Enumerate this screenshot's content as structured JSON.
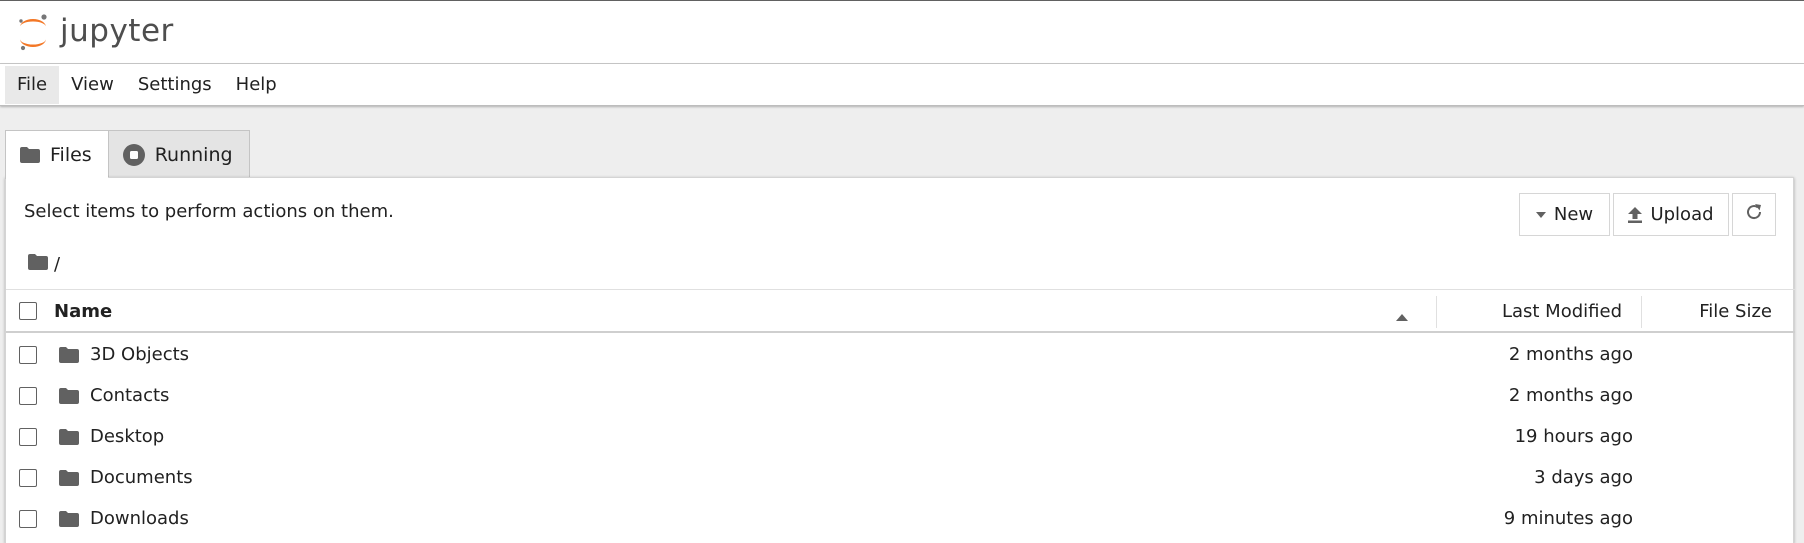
{
  "app": {
    "logo_text": "jupyter"
  },
  "menu": [
    {
      "label": "File",
      "active": true
    },
    {
      "label": "View"
    },
    {
      "label": "Settings"
    },
    {
      "label": "Help"
    }
  ],
  "tabs": [
    {
      "label": "Files",
      "icon": "folder-icon",
      "active": true
    },
    {
      "label": "Running",
      "icon": "stop-circle-icon",
      "active": false
    }
  ],
  "browser": {
    "instructions": "Select items to perform actions on them.",
    "buttons": {
      "new_label": "New",
      "upload_label": "Upload",
      "refresh_icon": "refresh-icon"
    },
    "breadcrumb": "/",
    "columns": {
      "name": "Name",
      "last_modified": "Last Modified",
      "file_size": "File Size"
    },
    "rows": [
      {
        "name": "3D Objects",
        "modified": "2 months ago",
        "icon": "folder-icon"
      },
      {
        "name": "Contacts",
        "modified": "2 months ago",
        "icon": "folder-icon"
      },
      {
        "name": "Desktop",
        "modified": "19 hours ago",
        "icon": "folder-icon"
      },
      {
        "name": "Documents",
        "modified": "3 days ago",
        "icon": "folder-icon"
      },
      {
        "name": "Downloads",
        "modified": "9 minutes ago",
        "icon": "folder-icon"
      }
    ]
  },
  "colors": {
    "logo_orange": "#f37726",
    "logo_gray": "#767677",
    "icon_gray": "#616161"
  }
}
